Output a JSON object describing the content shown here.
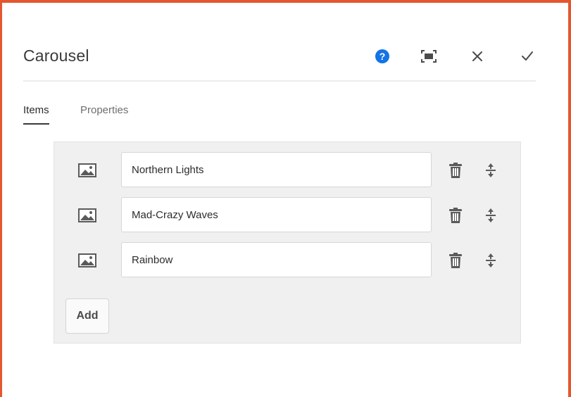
{
  "dialog": {
    "title": "Carousel",
    "actions": {
      "help": "help-icon",
      "fullscreen": "fullscreen-icon",
      "close": "close-icon",
      "done": "check-icon"
    }
  },
  "tabs": [
    {
      "label": "Items",
      "selected": true
    },
    {
      "label": "Properties",
      "selected": false
    }
  ],
  "items": [
    {
      "value": "Northern Lights",
      "icon": "image-icon"
    },
    {
      "value": "Mad-Crazy Waves",
      "icon": "image-icon"
    },
    {
      "value": "Rainbow",
      "icon": "image-icon"
    }
  ],
  "add_button": {
    "label": "Add"
  },
  "colors": {
    "accent": "#1473e6",
    "frame": "#e4572e",
    "panel": "#f0f0f0"
  }
}
